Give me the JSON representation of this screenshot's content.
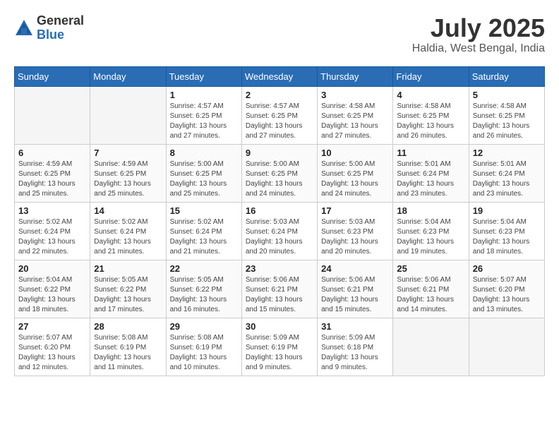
{
  "header": {
    "logo_general": "General",
    "logo_blue": "Blue",
    "month_year": "July 2025",
    "location": "Haldia, West Bengal, India"
  },
  "weekdays": [
    "Sunday",
    "Monday",
    "Tuesday",
    "Wednesday",
    "Thursday",
    "Friday",
    "Saturday"
  ],
  "weeks": [
    [
      {
        "day": "",
        "info": ""
      },
      {
        "day": "",
        "info": ""
      },
      {
        "day": "1",
        "info": "Sunrise: 4:57 AM\nSunset: 6:25 PM\nDaylight: 13 hours and 27 minutes."
      },
      {
        "day": "2",
        "info": "Sunrise: 4:57 AM\nSunset: 6:25 PM\nDaylight: 13 hours and 27 minutes."
      },
      {
        "day": "3",
        "info": "Sunrise: 4:58 AM\nSunset: 6:25 PM\nDaylight: 13 hours and 27 minutes."
      },
      {
        "day": "4",
        "info": "Sunrise: 4:58 AM\nSunset: 6:25 PM\nDaylight: 13 hours and 26 minutes."
      },
      {
        "day": "5",
        "info": "Sunrise: 4:58 AM\nSunset: 6:25 PM\nDaylight: 13 hours and 26 minutes."
      }
    ],
    [
      {
        "day": "6",
        "info": "Sunrise: 4:59 AM\nSunset: 6:25 PM\nDaylight: 13 hours and 25 minutes."
      },
      {
        "day": "7",
        "info": "Sunrise: 4:59 AM\nSunset: 6:25 PM\nDaylight: 13 hours and 25 minutes."
      },
      {
        "day": "8",
        "info": "Sunrise: 5:00 AM\nSunset: 6:25 PM\nDaylight: 13 hours and 25 minutes."
      },
      {
        "day": "9",
        "info": "Sunrise: 5:00 AM\nSunset: 6:25 PM\nDaylight: 13 hours and 24 minutes."
      },
      {
        "day": "10",
        "info": "Sunrise: 5:00 AM\nSunset: 6:25 PM\nDaylight: 13 hours and 24 minutes."
      },
      {
        "day": "11",
        "info": "Sunrise: 5:01 AM\nSunset: 6:24 PM\nDaylight: 13 hours and 23 minutes."
      },
      {
        "day": "12",
        "info": "Sunrise: 5:01 AM\nSunset: 6:24 PM\nDaylight: 13 hours and 23 minutes."
      }
    ],
    [
      {
        "day": "13",
        "info": "Sunrise: 5:02 AM\nSunset: 6:24 PM\nDaylight: 13 hours and 22 minutes."
      },
      {
        "day": "14",
        "info": "Sunrise: 5:02 AM\nSunset: 6:24 PM\nDaylight: 13 hours and 21 minutes."
      },
      {
        "day": "15",
        "info": "Sunrise: 5:02 AM\nSunset: 6:24 PM\nDaylight: 13 hours and 21 minutes."
      },
      {
        "day": "16",
        "info": "Sunrise: 5:03 AM\nSunset: 6:24 PM\nDaylight: 13 hours and 20 minutes."
      },
      {
        "day": "17",
        "info": "Sunrise: 5:03 AM\nSunset: 6:23 PM\nDaylight: 13 hours and 20 minutes."
      },
      {
        "day": "18",
        "info": "Sunrise: 5:04 AM\nSunset: 6:23 PM\nDaylight: 13 hours and 19 minutes."
      },
      {
        "day": "19",
        "info": "Sunrise: 5:04 AM\nSunset: 6:23 PM\nDaylight: 13 hours and 18 minutes."
      }
    ],
    [
      {
        "day": "20",
        "info": "Sunrise: 5:04 AM\nSunset: 6:22 PM\nDaylight: 13 hours and 18 minutes."
      },
      {
        "day": "21",
        "info": "Sunrise: 5:05 AM\nSunset: 6:22 PM\nDaylight: 13 hours and 17 minutes."
      },
      {
        "day": "22",
        "info": "Sunrise: 5:05 AM\nSunset: 6:22 PM\nDaylight: 13 hours and 16 minutes."
      },
      {
        "day": "23",
        "info": "Sunrise: 5:06 AM\nSunset: 6:21 PM\nDaylight: 13 hours and 15 minutes."
      },
      {
        "day": "24",
        "info": "Sunrise: 5:06 AM\nSunset: 6:21 PM\nDaylight: 13 hours and 15 minutes."
      },
      {
        "day": "25",
        "info": "Sunrise: 5:06 AM\nSunset: 6:21 PM\nDaylight: 13 hours and 14 minutes."
      },
      {
        "day": "26",
        "info": "Sunrise: 5:07 AM\nSunset: 6:20 PM\nDaylight: 13 hours and 13 minutes."
      }
    ],
    [
      {
        "day": "27",
        "info": "Sunrise: 5:07 AM\nSunset: 6:20 PM\nDaylight: 13 hours and 12 minutes."
      },
      {
        "day": "28",
        "info": "Sunrise: 5:08 AM\nSunset: 6:19 PM\nDaylight: 13 hours and 11 minutes."
      },
      {
        "day": "29",
        "info": "Sunrise: 5:08 AM\nSunset: 6:19 PM\nDaylight: 13 hours and 10 minutes."
      },
      {
        "day": "30",
        "info": "Sunrise: 5:09 AM\nSunset: 6:19 PM\nDaylight: 13 hours and 9 minutes."
      },
      {
        "day": "31",
        "info": "Sunrise: 5:09 AM\nSunset: 6:18 PM\nDaylight: 13 hours and 9 minutes."
      },
      {
        "day": "",
        "info": ""
      },
      {
        "day": "",
        "info": ""
      }
    ]
  ]
}
